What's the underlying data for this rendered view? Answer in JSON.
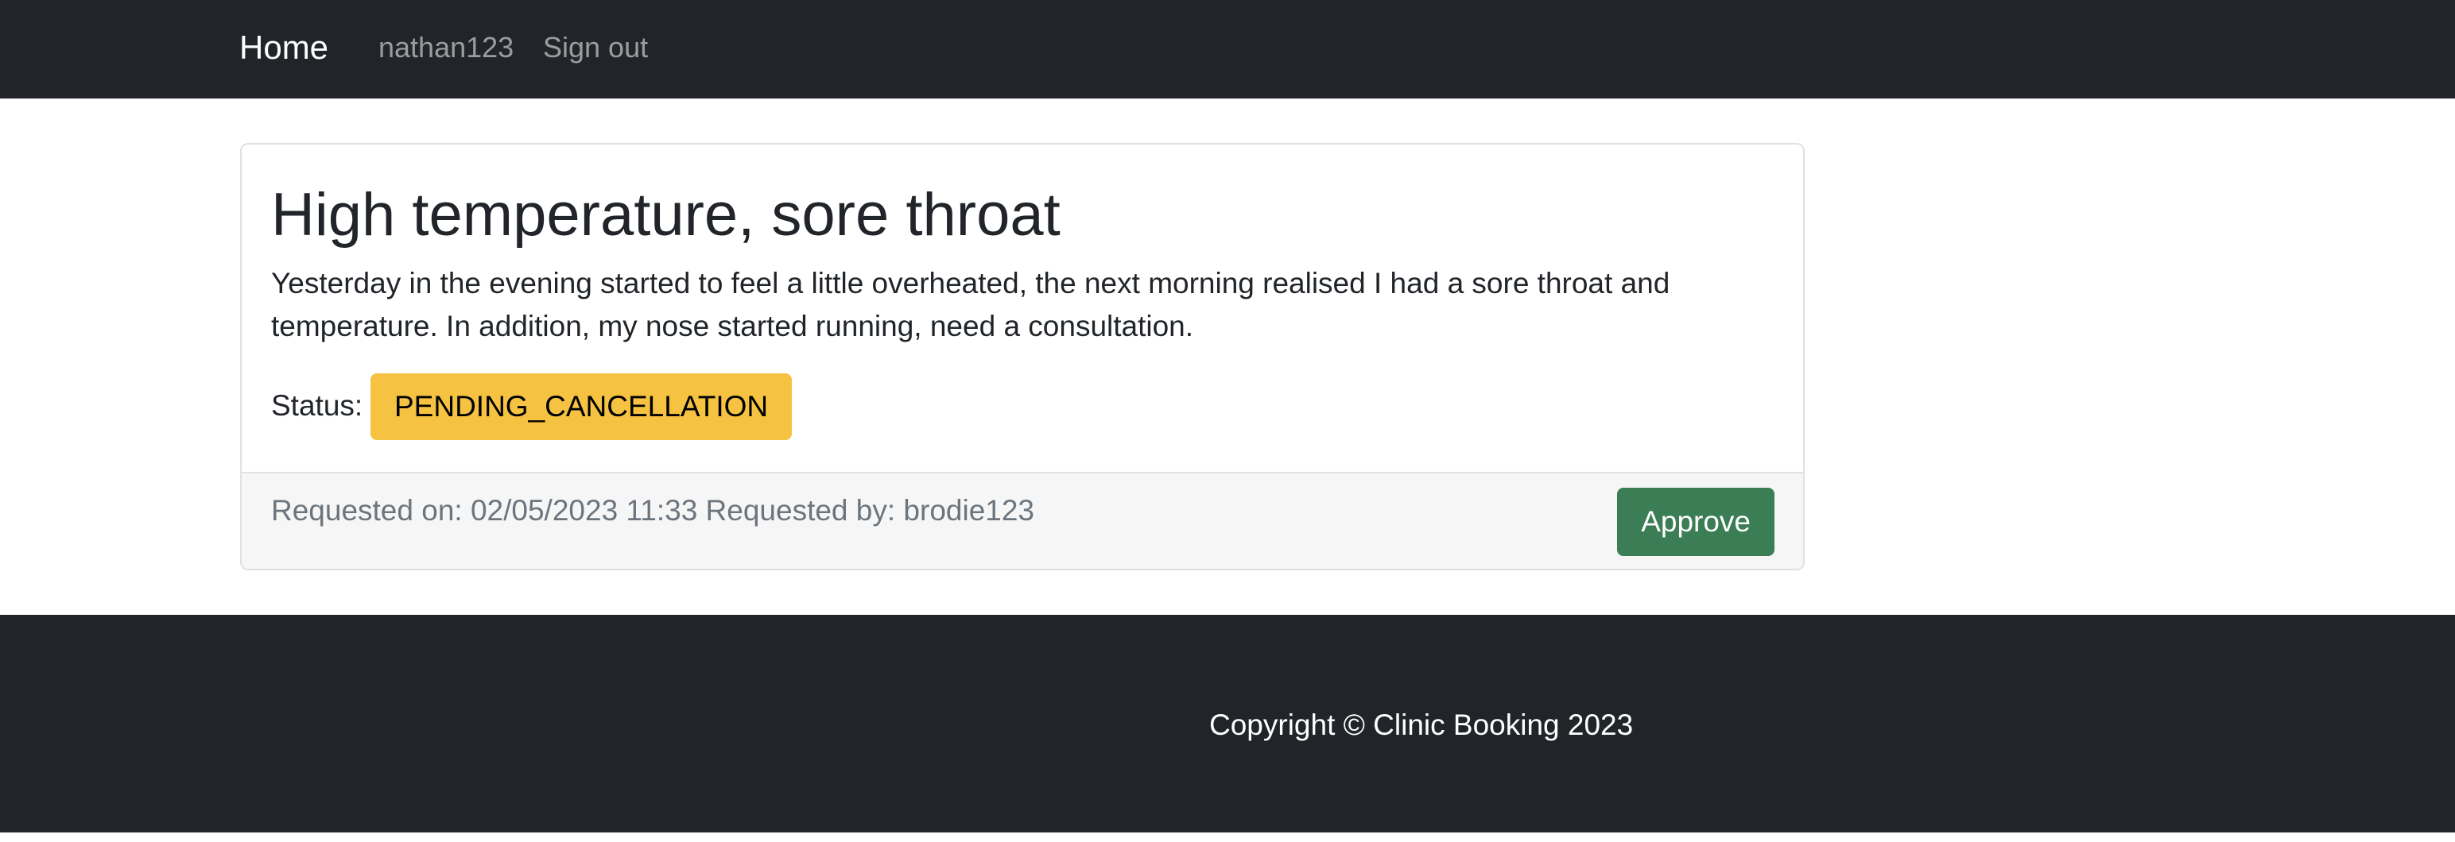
{
  "navbar": {
    "brand": "Home",
    "user": "nathan123",
    "sign_out": "Sign out"
  },
  "request": {
    "title": "High temperature, sore throat",
    "description": "Yesterday in the evening started to feel a little overheated, the next morning realised I had a sore throat and temperature. In addition, my nose started running, need a consultation.",
    "status_label": "Status:",
    "status_value": "PENDING_CANCELLATION",
    "meta": "Requested on: 02/05/2023 11:33 Requested by: brodie123",
    "approve_label": "Approve"
  },
  "footer": {
    "copyright": "Copyright © Clinic Booking 2023"
  },
  "colors": {
    "navbar_bg": "#212529",
    "status_badge": "#f5c242",
    "approve_button": "#3b7d55"
  }
}
